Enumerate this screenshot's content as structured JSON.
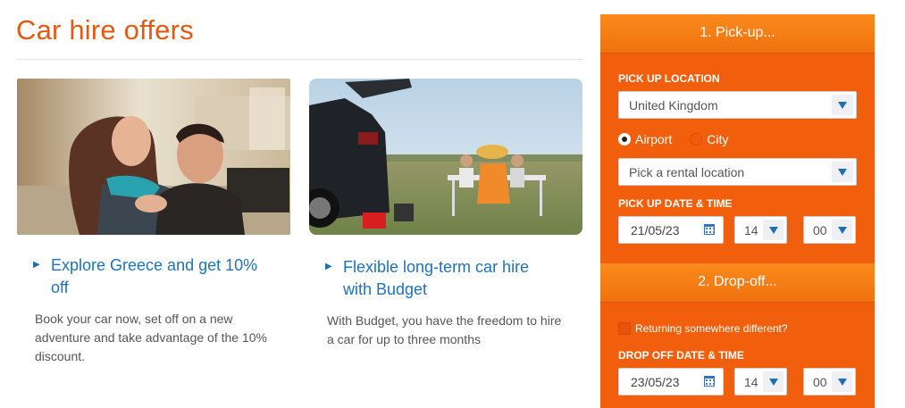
{
  "page_title": "Car hire offers",
  "offers": [
    {
      "image": "couple-photo",
      "link": "Explore Greece and get 10% off",
      "description": "Book your car now, set off on a new adventure and take advantage of the 10% discount."
    },
    {
      "image": "picnic-car-photo",
      "link": "Flexible long-term car hire with Budget",
      "description": "With Budget, you have the freedom to hire a car for up to three months"
    }
  ],
  "panel": {
    "pickup_header": "1. Pick-up...",
    "pickup_location_label": "PICK UP LOCATION",
    "country_value": "United Kingdom",
    "radio_airport": "Airport",
    "radio_city": "City",
    "rental_location_value": "Pick a rental location",
    "pickup_datetime_label": "PICK UP DATE & TIME",
    "pickup_date": "21/05/23",
    "pickup_hour": "14",
    "pickup_minute": "00",
    "dropoff_header": "2. Drop-off...",
    "returning_different": "Returning somewhere different?",
    "dropoff_datetime_label": "DROP OFF DATE & TIME",
    "dropoff_date": "23/05/23",
    "dropoff_hour": "14",
    "dropoff_minute": "00"
  },
  "colors": {
    "title": "#e35a14",
    "panel": "#f25f0c",
    "link": "#1f73b7"
  }
}
